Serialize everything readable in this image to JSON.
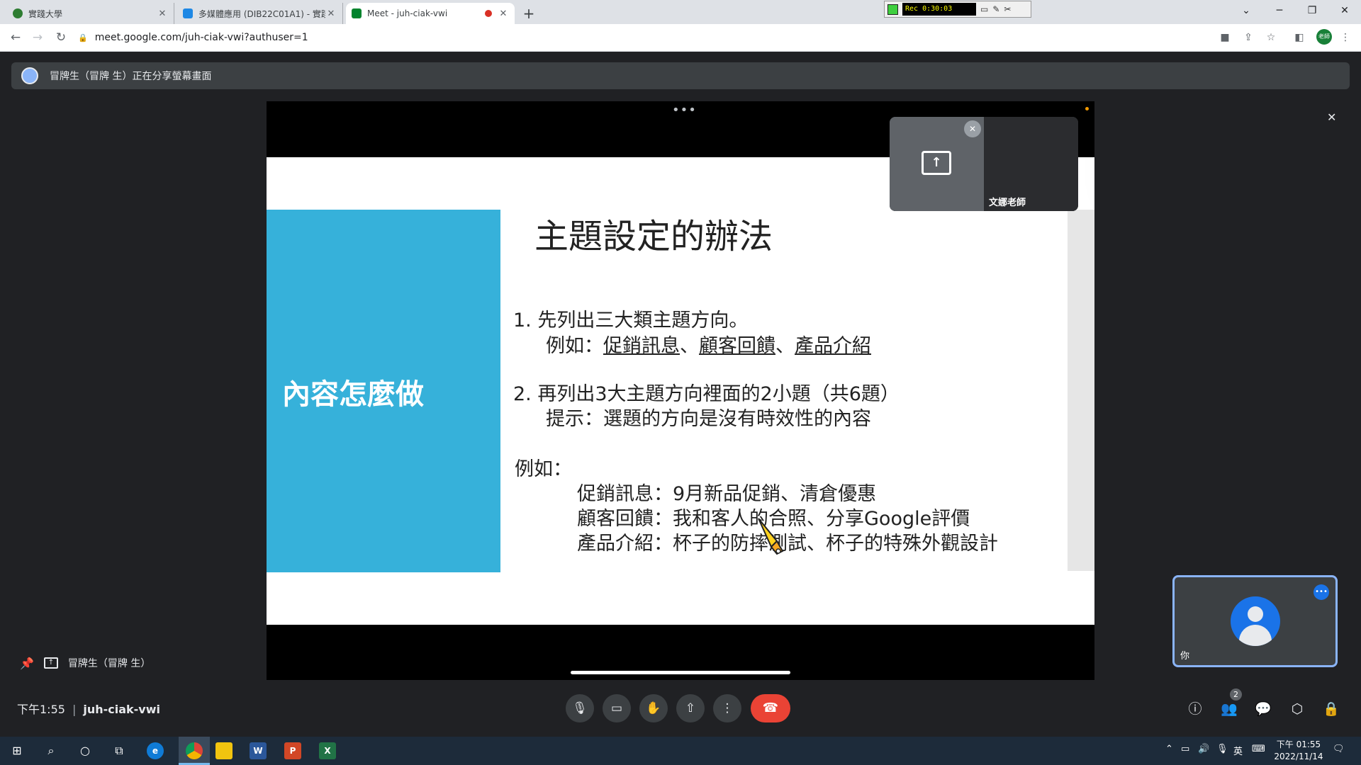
{
  "browser": {
    "tabs": [
      {
        "title": "實踐大學",
        "favicon_color": "#2e7d32"
      },
      {
        "title": "多媒體應用 (DIB22C01A1) - 實踐",
        "favicon_color": "#1e88e5"
      },
      {
        "title": "Meet - juh-ciak-vwi",
        "favicon_color": "#00832d",
        "recording_dot_color": "#d93025"
      }
    ],
    "new_tab_icon": "+",
    "url": "meet.google.com/juh-ciak-vwi?authuser=1",
    "profile_label": "老師",
    "recorder": {
      "time": "Rec 0:30:03"
    },
    "window_controls": [
      "⌄",
      "─",
      "❐",
      "✕"
    ]
  },
  "meet": {
    "banner_text": "冒牌生（冒牌 生）正在分享螢幕畫面",
    "more_dots": "•••",
    "presenter_tile_name": "文娜老師",
    "self_label": "你",
    "presenter_label": "冒牌生（冒牌 生）",
    "time": "下午1:55",
    "separator": "|",
    "meeting_code": "juh-ciak-vwi",
    "participant_count": "2",
    "accent": "#8ab4f8",
    "hangup_color": "#ea4335"
  },
  "slide": {
    "left_title": "內容怎麼做",
    "title": "主題設定的辦法",
    "item1_line1": "1.  先列出三大類主題方向。",
    "item1_prefix": "例如：",
    "item1_links": [
      "促銷訊息",
      "顧客回饋",
      "產品介紹"
    ],
    "item1_sep": "、",
    "item2_line1": "2.  再列出3大主題方向裡面的2小題（共6題）",
    "item2_line2": "提示：選題的方向是沒有時效性的內容",
    "example_label": "例如：",
    "example1": "促銷訊息：9月新品促銷、清倉優惠",
    "example2": "顧客回饋：我和客人的合照、分享Google評價",
    "example3": "產品介紹：杯子的防摔測試、杯子的特殊外觀設計",
    "blue": "#36b1da"
  },
  "taskbar": {
    "clock_time": "下午 01:55",
    "clock_date": "2022/11/14",
    "ime": "英",
    "apps": [
      "W",
      "P",
      "X"
    ]
  }
}
